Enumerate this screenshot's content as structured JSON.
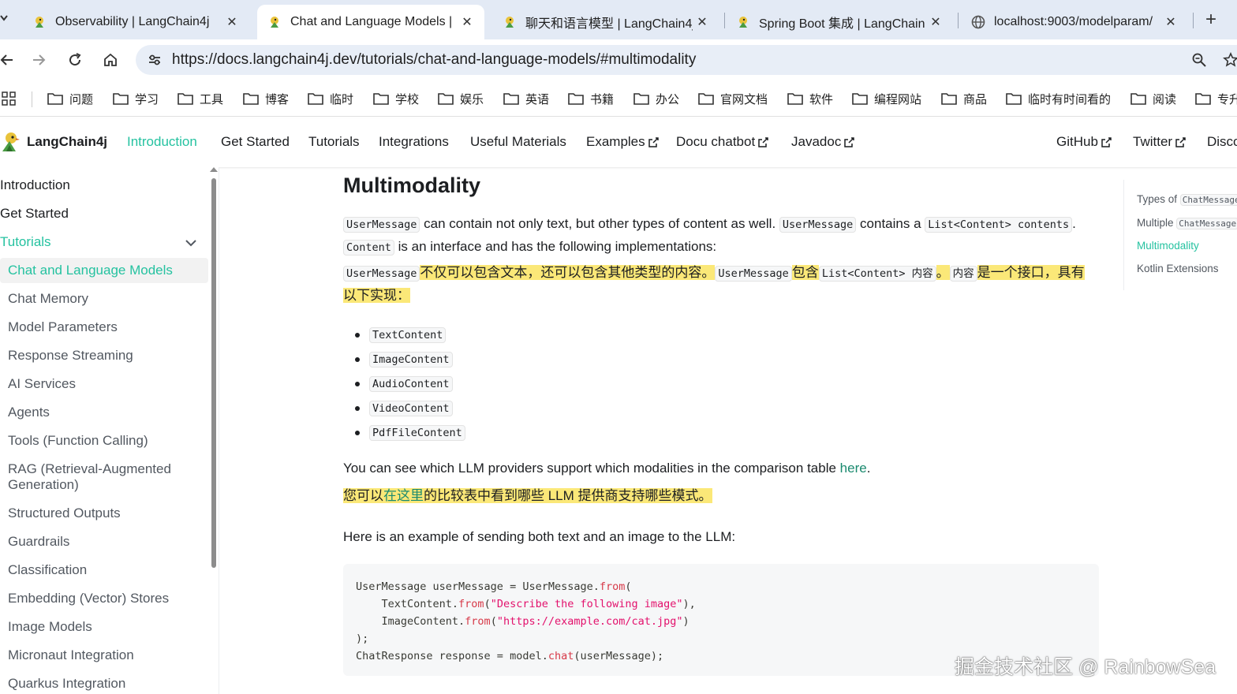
{
  "tabs": [
    {
      "title": "Observability | LangChain4j"
    },
    {
      "title": "Chat and Language Models |"
    },
    {
      "title": "聊天和语言模型 | LangChain4j"
    },
    {
      "title": "Spring Boot 集成 | LangChain"
    },
    {
      "title": "localhost:9003/modelparam/"
    }
  ],
  "address": {
    "url": "https://docs.langchain4j.dev/tutorials/chat-and-language-models/#multimodality"
  },
  "bookmarks": [
    "问题",
    "学习",
    "工具",
    "博客",
    "临时",
    "学校",
    "娱乐",
    "英语",
    "书籍",
    "办公",
    "官网文档",
    "软件",
    "编程网站",
    "商品",
    "临时有时间看的",
    "阅读",
    "专升"
  ],
  "navbar": {
    "brand": "LangChain4j",
    "links": [
      "Introduction",
      "Get Started",
      "Tutorials",
      "Integrations",
      "Useful Materials",
      "Examples",
      "Docu chatbot",
      "Javadoc"
    ],
    "right_links": [
      "GitHub",
      "Twitter",
      "Disco"
    ]
  },
  "sidebar": {
    "top": [
      "Introduction",
      "Get Started",
      "Tutorials"
    ],
    "sub": [
      "Chat and Language Models",
      "Chat Memory",
      "Model Parameters",
      "Response Streaming",
      "AI Services",
      "Agents",
      "Tools (Function Calling)",
      "RAG (Retrieval-Augmented",
      "Generation)",
      "Structured Outputs",
      "Guardrails",
      "Classification",
      "Embedding (Vector) Stores",
      "Image Models",
      "Micronaut Integration",
      "Quarkus Integration"
    ]
  },
  "content": {
    "heading": "Multimodality",
    "p1": {
      "c1": "UserMessage",
      "t1": " can contain not only text, but other types of content as well. ",
      "c2": "UserMessage",
      "t2": " contains a ",
      "c3": "List<Content> contents",
      "t3": ".",
      "c4": "Content",
      "t4": " is an interface and has the following implementations:"
    },
    "p1_zh": {
      "c1": "UserMessage",
      "t1": "不仅可以包含文本，还可以包含其他类型的内容。",
      "c2": "UserMessage",
      "t2": "包含",
      "c3": "List<Content> 内容",
      "t3": "。",
      "c4": "内容",
      "t4": "是一个接口，具有以下实现："
    },
    "implementations": [
      "TextContent",
      "ImageContent",
      "AudioContent",
      "VideoContent",
      "PdfFileContent"
    ],
    "p2": {
      "before": "You can see which LLM providers support which modalities in the comparison table ",
      "link": "here",
      "after": "."
    },
    "p2_zh": {
      "before": "您可以",
      "link": "在这里",
      "after": "的比较表中看到哪些 LLM 提供商支持哪些模式。"
    },
    "p3": "Here is an example of sending both text and an image to the LLM:",
    "code": {
      "l1a": "UserMessage userMessage = UserMessage.",
      "l1fn": "from",
      "l1b": "(",
      "l2a": "    TextContent.",
      "l2fn": "from",
      "l2b": "(",
      "l2str": "\"Describe the following image\"",
      "l2c": "),",
      "l3a": "    ImageContent.",
      "l3fn": "from",
      "l3b": "(",
      "l3str": "\"https://example.com/cat.jpg\"",
      "l3c": ")",
      "l4": ");",
      "l5a": "ChatResponse response = model.",
      "l5fn": "chat",
      "l5b": "(userMessage);"
    }
  },
  "toc": {
    "item1": {
      "text": "Types of ",
      "code": "ChatMessage"
    },
    "item2": {
      "text": "Multiple ",
      "code": "ChatMessage"
    },
    "item3": "Multimodality",
    "item4": "Kotlin Extensions"
  },
  "watermark": "掘金技术社区 @ RainbowSea",
  "colors": {
    "accent": "#25c2a0",
    "highlight": "#fbe878",
    "tabstrip": "#e3eaf5"
  }
}
